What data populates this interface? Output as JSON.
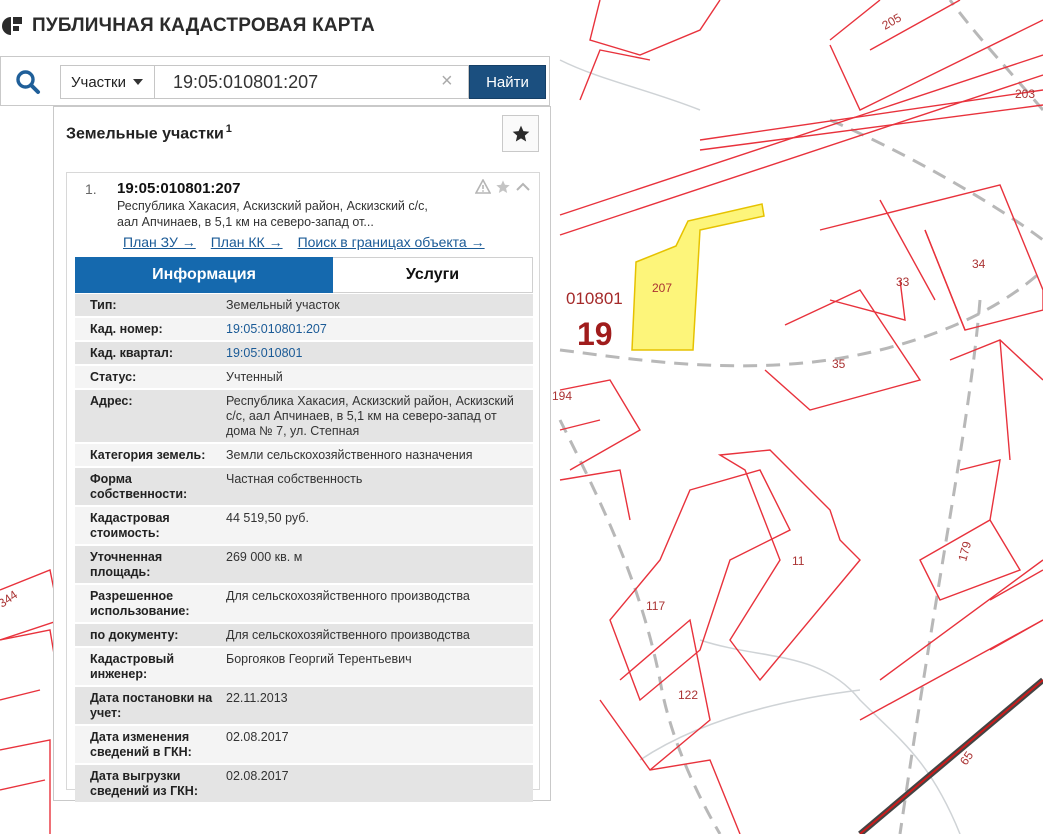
{
  "app": {
    "title": "ПУБЛИЧНАЯ КАДАСТРОВАЯ КАРТА"
  },
  "search": {
    "type_label": "Участки",
    "query": "19:05:010801:207",
    "find_label": "Найти"
  },
  "panel": {
    "title": "Земельные участки",
    "count": "1"
  },
  "result": {
    "index": "1.",
    "cad_number": "19:05:010801:207",
    "address_short": "Республика Хакасия, Аскизский район, Аскизский с/с, аал Апчинаев, в 5,1 км на северо-запад от...",
    "links": [
      "План ЗУ →",
      "План КК →",
      "Поиск в границах объекта →"
    ]
  },
  "tabs": {
    "info": "Информация",
    "services": "Услуги"
  },
  "info_rows": [
    {
      "key": "Тип:",
      "value": "Земельный участок"
    },
    {
      "key": "Кад. номер:",
      "value": "19:05:010801:207"
    },
    {
      "key": "Кад. квартал:",
      "value": "19:05:010801"
    },
    {
      "key": "Статус:",
      "value": "Учтенный"
    },
    {
      "key": "Адрес:",
      "value": "Республика Хакасия, Аскизский район, Аскизский с/с, аал Апчинаев, в 5,1 км на северо-запад от дома № 7, ул. Степная"
    },
    {
      "key": "Категория земель:",
      "value": "Земли сельскохозяйственного назначения"
    },
    {
      "key": "Форма собственности:",
      "value": "Частная собственность"
    },
    {
      "key": "Кадастровая стоимость:",
      "value": "44 519,50 руб."
    },
    {
      "key": "Уточненная площадь:",
      "value": "269 000 кв. м"
    },
    {
      "key": "Разрешенное использование:",
      "value": "Для сельскохозяйственного производства"
    },
    {
      "key": "по документу:",
      "value": "Для сельскохозяйственного производства"
    },
    {
      "key": "Кадастровый инженер:",
      "value": "Боргояков Георгий Терентьевич"
    },
    {
      "key": "Дата постановки на учет:",
      "value": "22.11.2013"
    },
    {
      "key": "Дата изменения сведений в ГКН:",
      "value": "02.08.2017"
    },
    {
      "key": "Дата выгрузки сведений из ГКН:",
      "value": "02.08.2017"
    }
  ],
  "map_labels": {
    "quarter": "010801",
    "district": "19",
    "parcels": [
      "207",
      "205",
      "203",
      "34",
      "33",
      "35",
      "194",
      "11",
      "117",
      "122",
      "179",
      "344",
      "65"
    ]
  },
  "colors": {
    "parcel_border": "#e8323c",
    "selected_fill": "#fdf57a",
    "accent_dark": "#1b4f7f",
    "tab_active": "#1569ae",
    "link": "#1a5a96"
  }
}
